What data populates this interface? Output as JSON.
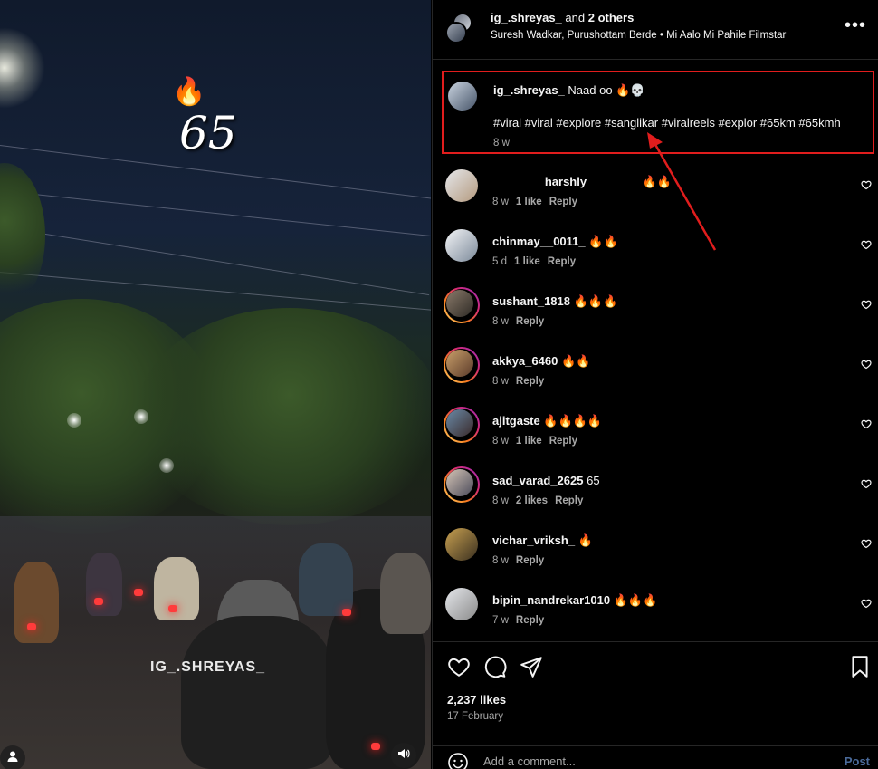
{
  "video": {
    "overlay_fire": "🔥",
    "overlay_number": "65",
    "watermark": "IG_.SHREYAS_"
  },
  "header": {
    "author": "ig_.shreyas_",
    "and_text": "and",
    "others": "2 others",
    "audio": "Suresh Wadkar, Purushottam Berde • Mi Aalo Mi Pahile Filmstar"
  },
  "caption": {
    "user": "ig_.shreyas_",
    "text": "Naad oo 🔥💀",
    "hashtags": "#viral #viral #explore #sanglikar #viralreels #explor #65km #65kmh",
    "time": "8 w"
  },
  "comments": [
    {
      "user": "________harshly________",
      "text": "🔥🔥",
      "time": "8 w",
      "likes": "1 like",
      "reply": "Reply",
      "ring": false
    },
    {
      "user": "chinmay__0011_",
      "text": "🔥🔥",
      "time": "5 d",
      "likes": "1 like",
      "reply": "Reply",
      "ring": false
    },
    {
      "user": "sushant_1818",
      "text": "🔥🔥🔥",
      "time": "8 w",
      "likes": "",
      "reply": "Reply",
      "ring": true
    },
    {
      "user": "akkya_6460",
      "text": "🔥🔥",
      "time": "8 w",
      "likes": "",
      "reply": "Reply",
      "ring": true
    },
    {
      "user": "ajitgaste",
      "text": "🔥🔥🔥🔥",
      "time": "8 w",
      "likes": "1 like",
      "reply": "Reply",
      "ring": true
    },
    {
      "user": "sad_varad_2625",
      "text": "65",
      "time": "8 w",
      "likes": "2 likes",
      "reply": "Reply",
      "ring": true
    },
    {
      "user": "vichar_vriksh_",
      "text": "🔥",
      "time": "8 w",
      "likes": "",
      "reply": "Reply",
      "ring": false
    },
    {
      "user": "bipin_nandrekar1010",
      "text": "🔥🔥🔥",
      "time": "7 w",
      "likes": "",
      "reply": "Reply",
      "ring": false
    }
  ],
  "footer": {
    "likes": "2,237 likes",
    "date": "17 February",
    "comment_placeholder": "Add a comment...",
    "post_label": "Post"
  },
  "colors": {
    "annotation": "#e11d1d",
    "post_button": "#4a6a9a",
    "secondary_text": "#a8a8a8"
  }
}
